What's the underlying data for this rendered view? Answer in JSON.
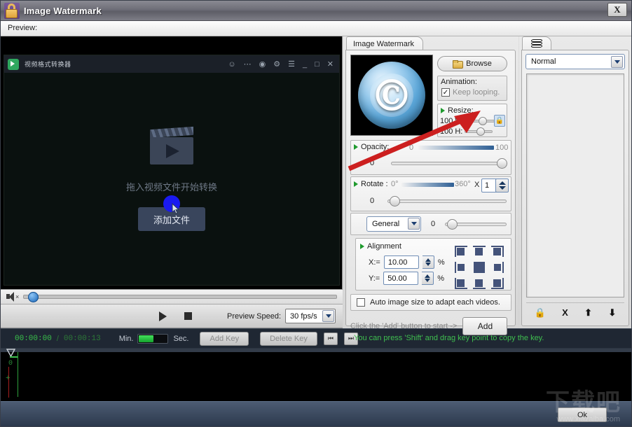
{
  "window": {
    "title": "Image Watermark",
    "icon": "padlock-icon",
    "close_label": "X"
  },
  "preview": {
    "label": "Preview:",
    "inner_app": {
      "title": "视频格式转换器",
      "drop_hint": "拖入视频文件开始转换",
      "add_file_button": "添加文件",
      "window_icons": [
        "account-icon",
        "more-icon",
        "smiley-icon",
        "settings-icon",
        "menu-icon",
        "minimize-icon",
        "maximize-icon",
        "close-icon"
      ]
    },
    "volume": {
      "icon": "speaker-muted-icon",
      "value": 2
    },
    "transport": {
      "play": "play-icon",
      "stop": "stop-icon",
      "speed_label": "Preview Speed:",
      "speed_value": "30 fps/s"
    }
  },
  "timeline": {
    "current_time": "00:00:00",
    "separator": "/",
    "total_time": "00:00:13",
    "min_label": "Min.",
    "sec_label": "Sec.",
    "add_key": "Add Key",
    "delete_key": "Delete Key",
    "prev_key_icon": "skip-previous-icon",
    "next_key_icon": "skip-next-icon",
    "hint": "You can press 'Shift' and drag key point to copy the key.",
    "track_zero_label": "0",
    "track_plus_label": "+"
  },
  "options": {
    "tab_label": "Image Watermark",
    "thumbnail_glyph": "©",
    "browse_button": "Browse",
    "animation": {
      "label": "Animation:",
      "keep_looping": "Keep looping.",
      "checked": true,
      "check_glyph": "✓"
    },
    "resize": {
      "label": "Resize:",
      "width_value": "100",
      "width_label": "W:",
      "height_value": "100",
      "height_label": "H:",
      "lock_icon": "lock-icon",
      "locked": true
    },
    "opacity": {
      "label": "Opacity:",
      "min": "0",
      "max": "100",
      "value": "0",
      "slider_percent": 100
    },
    "rotate": {
      "label": "Rotate :",
      "min": "0°",
      "max": "360°",
      "multiplier_symbol": "X",
      "multiplier_value": "1",
      "value": "0",
      "slider_percent": 4
    },
    "general": {
      "selected": "General",
      "value": "0",
      "slider_percent": 3
    },
    "alignment": {
      "label": "Alignment",
      "x_label": "X:=",
      "x_value": "10.00",
      "x_unit": "%",
      "y_label": "Y:=",
      "y_value": "50.00",
      "y_unit": "%"
    },
    "auto_size": {
      "label": "Auto image size to adapt each videos.",
      "checked": false
    },
    "add": {
      "hint": "Click the 'Add' button to start ->",
      "button": "Add"
    }
  },
  "layers": {
    "tab_icon": "layers-icon",
    "blend_mode": "Normal",
    "items": [],
    "tools": [
      {
        "name": "lock-icon",
        "glyph": "🔒"
      },
      {
        "name": "delete-icon",
        "glyph": "X"
      },
      {
        "name": "move-up-icon",
        "glyph": "↑"
      },
      {
        "name": "move-down-icon",
        "glyph": "↓"
      }
    ]
  },
  "footer": {
    "ok_button": "Ok",
    "watermark": "下载吧",
    "watermark_url": "www.xiazaiba.com"
  },
  "colors": {
    "accent_green": "#3fbf4f",
    "accent_blue": "#1a66b8",
    "arrow_red": "#cc1f1f",
    "panel_bg": "#e9e9e9"
  }
}
